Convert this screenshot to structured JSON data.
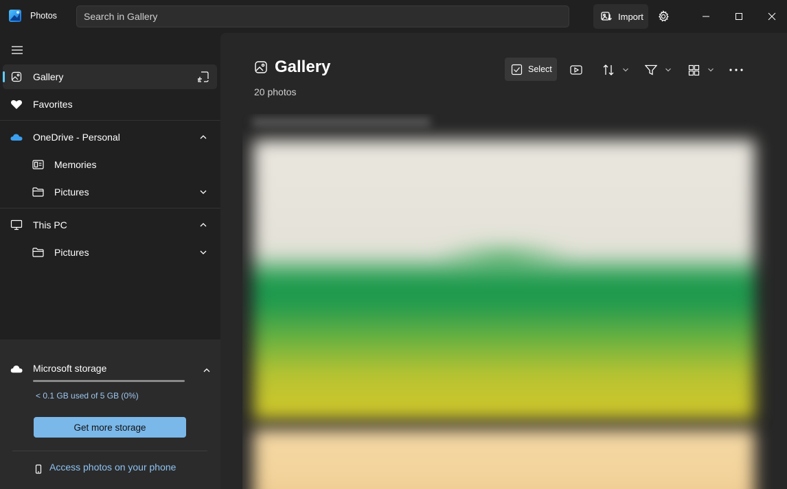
{
  "titlebar": {
    "app_name": "Photos",
    "search_placeholder": "Search in Gallery",
    "import_label": "Import",
    "icons": [
      "photos-logo-icon",
      "import-icon",
      "gear-icon",
      "minimize-icon",
      "maximize-icon",
      "close-icon"
    ]
  },
  "sidebar": {
    "items": [
      {
        "label": "Gallery",
        "icon": "gallery-icon",
        "active": true
      },
      {
        "label": "Favorites",
        "icon": "heart-icon"
      },
      {
        "label": "OneDrive - Personal",
        "icon": "cloud-icon",
        "expanded": true
      },
      {
        "label": "Memories",
        "icon": "memories-icon"
      },
      {
        "label": "Pictures",
        "icon": "folder-icon",
        "expanded": false
      },
      {
        "label": "This PC",
        "icon": "computer-icon",
        "expanded": true
      },
      {
        "label": "Pictures",
        "icon": "folder-icon",
        "expanded": false
      }
    ],
    "storage": {
      "label": "Microsoft storage",
      "used_fraction": 0.0,
      "usage_text": "< 0.1 GB used of 5 GB (0%)",
      "button_label": "Get more storage"
    },
    "phone_link": "Access photos on your phone"
  },
  "main": {
    "title": "Gallery",
    "photo_count": "20 photos",
    "toolbar": {
      "select_label": "Select",
      "icons": [
        "slideshow-icon",
        "sort-icon",
        "filter-icon",
        "view-layout-icon",
        "more-icon"
      ]
    }
  },
  "colors": {
    "background": "#202020",
    "main_background": "#272727",
    "accent": "#60cdff",
    "storage_button": "#7ab8ea",
    "link": "#8ec3f3"
  }
}
